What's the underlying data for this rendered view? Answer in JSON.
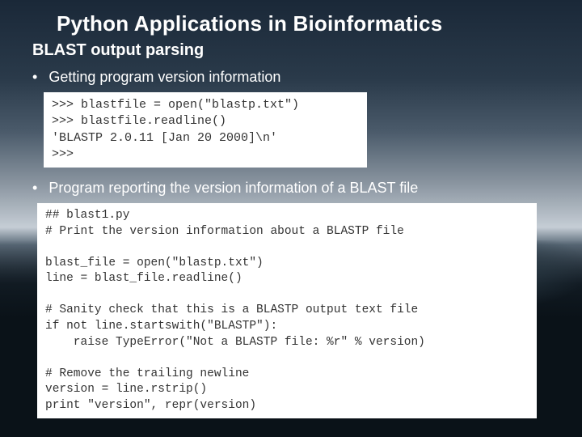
{
  "title": "Python Applications in Bioinformatics",
  "subtitle": "BLAST output parsing",
  "bullets": {
    "b1": "Getting program version information",
    "b2": "Program reporting the version information of a BLAST file"
  },
  "code1": ">>> blastfile = open(\"blastp.txt\")\n>>> blastfile.readline()\n'BLASTP 2.0.11 [Jan 20 2000]\\n'\n>>>",
  "code2": "## blast1.py\n# Print the version information about a BLASTP file\n\nblast_file = open(\"blastp.txt\")\nline = blast_file.readline()\n\n# Sanity check that this is a BLASTP output text file\nif not line.startswith(\"BLASTP\"):\n    raise TypeError(\"Not a BLASTP file: %r\" % version)\n\n# Remove the trailing newline\nversion = line.rstrip()\nprint \"version\", repr(version)"
}
